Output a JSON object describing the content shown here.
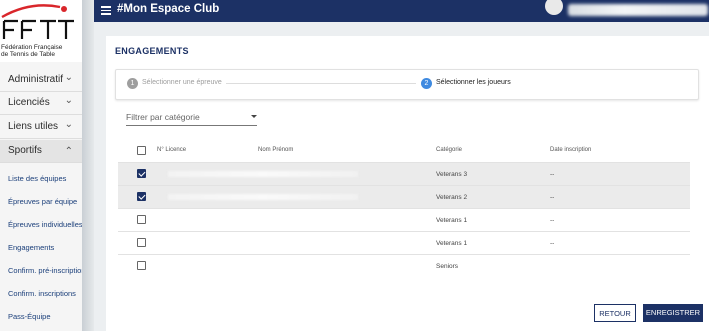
{
  "logo": {
    "letters": "FFTT",
    "line1": "Fédération Française",
    "line2": "de Tennis de Table"
  },
  "sidebar": {
    "items": [
      {
        "label": "Administratif",
        "chevron": "chevron-down-icon"
      },
      {
        "label": "Licenciés",
        "chevron": "chevron-down-icon"
      },
      {
        "label": "Liens utiles",
        "chevron": "chevron-down-icon"
      },
      {
        "label": "Sportifs",
        "chevron": "chevron-up-icon"
      }
    ],
    "sub_items": [
      "Liste des équipes",
      "Épreuves par équipe",
      "Épreuves individuelles",
      "Engagements",
      "Confirm. pré-inscriptions",
      "Confirm. inscriptions",
      "Pass-Équipe"
    ]
  },
  "topbar": {
    "title": "#Mon Espace Club",
    "bg_color": "#1c3165"
  },
  "page": {
    "title": "ENGAGEMENTS"
  },
  "stepper": {
    "step1": {
      "number": "1",
      "label": "Sélectionner une épreuve"
    },
    "step2": {
      "number": "2",
      "label": "Sélectionner les joueurs"
    }
  },
  "filter": {
    "placeholder": "Filtrer par catégorie"
  },
  "table": {
    "headers": {
      "licence": "N° Licence",
      "name": "Nom Prénom",
      "category": "Catégorie",
      "date": "Date inscription"
    },
    "rows": [
      {
        "checked": true,
        "category": "Veterans 3",
        "date": "--"
      },
      {
        "checked": true,
        "category": "Veterans 2",
        "date": "--"
      },
      {
        "checked": false,
        "category": "Veterans 1",
        "date": "--"
      },
      {
        "checked": false,
        "category": "Veterans 1",
        "date": "--"
      },
      {
        "checked": false,
        "category": "Seniors",
        "date": "--"
      }
    ]
  },
  "buttons": {
    "back": "RETOUR",
    "save": "ENREGISTRER"
  }
}
